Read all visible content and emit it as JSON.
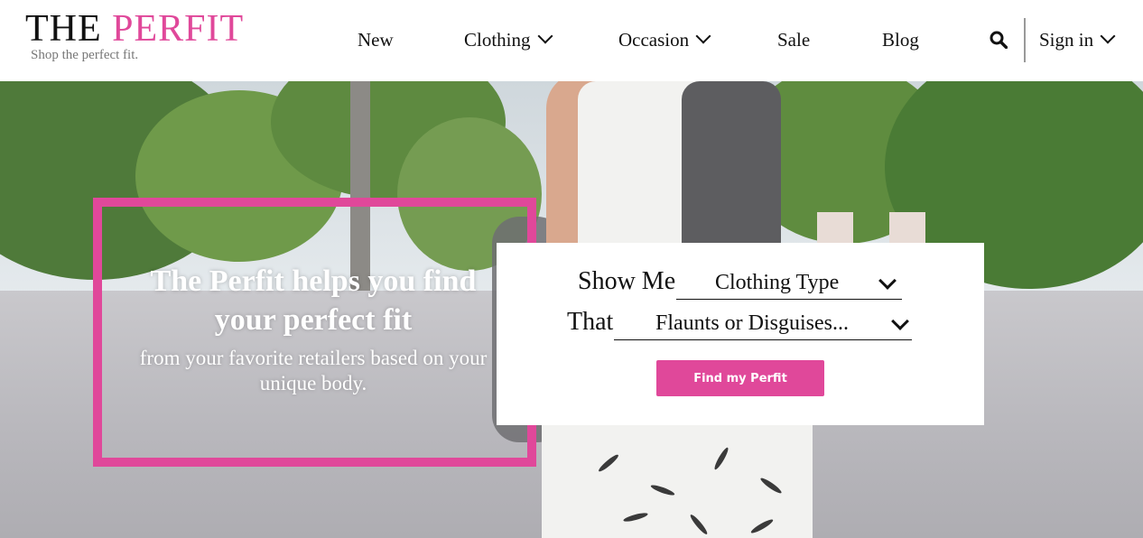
{
  "brand": {
    "logo_the": "THE",
    "logo_perfit": "PERFIT",
    "tagline": "Shop the perfect fit.",
    "accent_color": "#e0489a"
  },
  "nav": {
    "new": "New",
    "clothing": "Clothing",
    "occasion": "Occasion",
    "sale": "Sale",
    "blog": "Blog",
    "sign_in": "Sign in",
    "search_icon": "search-icon",
    "dropdown_icon": "chevron-down-icon"
  },
  "hero": {
    "headline": "The Perfit helps you find your perfect fit",
    "subheadline": "from your favorite retailers based on your unique body."
  },
  "finder": {
    "show_me_label": "Show Me",
    "clothing_type_value": "Clothing Type",
    "that_label": "That",
    "flaunts_value": "Flaunts or Disguises...",
    "button_label": "Find my Perfit"
  }
}
